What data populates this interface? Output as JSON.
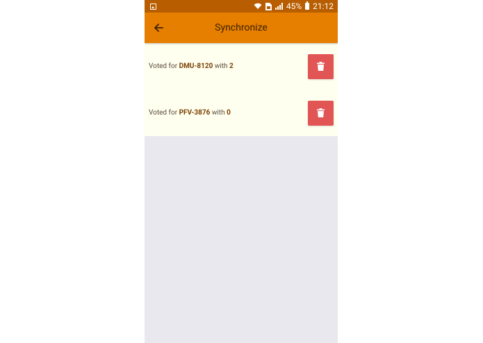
{
  "status_bar": {
    "battery_percent": "45%",
    "time": "21:12"
  },
  "app_bar": {
    "title": "Synchronize"
  },
  "votes": [
    {
      "prefix": "Voted for",
      "code": "DMU-8120",
      "middle": "with",
      "value": "2"
    },
    {
      "prefix": "Voted for",
      "code": "PFV-3876",
      "middle": "with",
      "value": "0"
    }
  ],
  "colors": {
    "status_bar": "#b85e00",
    "app_bar": "#e67e00",
    "list_bg": "#fffff0",
    "delete_button": "#e25555",
    "empty_bg": "#e8e8ee"
  },
  "icons": {
    "back": "arrow-back-icon",
    "delete": "trash-icon",
    "wifi": "wifi-icon",
    "signal": "signal-icon",
    "battery": "battery-icon",
    "image": "image-notification-icon",
    "sim": "sim-icon"
  }
}
